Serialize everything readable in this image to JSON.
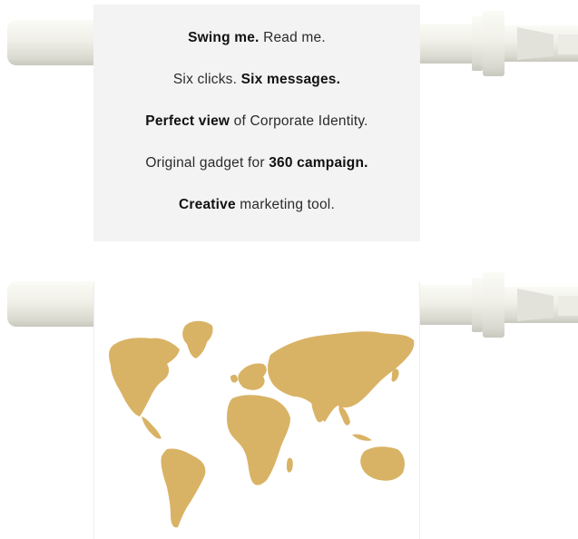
{
  "panel_text": {
    "lines": [
      {
        "bold": "Swing me.",
        "regular": " Read me.",
        "order": "bold-first"
      },
      {
        "regular": "Six clicks. ",
        "bold": "Six messages.",
        "order": "regular-first"
      },
      {
        "bold": "Perfect view",
        "regular": " of Corporate Identity.",
        "order": "bold-first"
      },
      {
        "regular": "Original gadget for ",
        "bold": "360 campaign.",
        "order": "regular-first"
      },
      {
        "bold": "Creative",
        "regular": " marketing tool.",
        "order": "bold-first"
      }
    ]
  },
  "panel_map": {
    "icon": "world-map-icon",
    "fill_color": "#d9b365"
  },
  "rod": {
    "color": "#f1f1ea"
  }
}
